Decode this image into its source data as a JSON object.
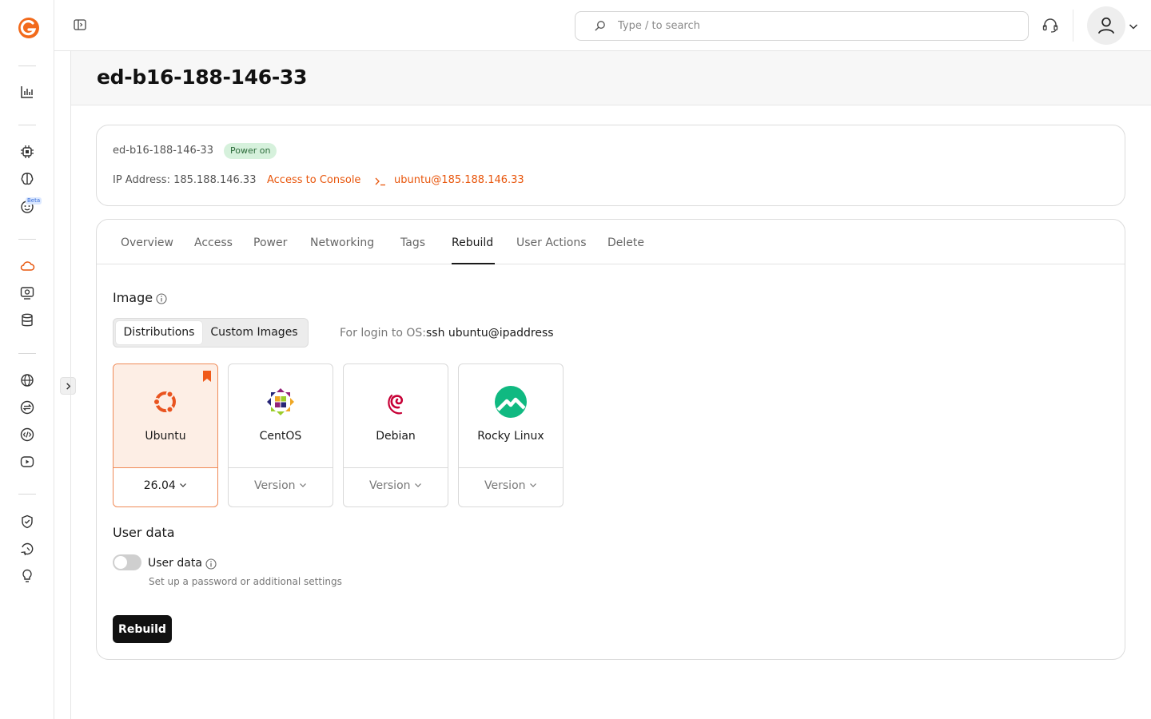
{
  "header": {
    "search_placeholder": "Type / to search"
  },
  "page": {
    "title": "ed-b16-188-146-33"
  },
  "server": {
    "hostname": "ed-b16-188-146-33",
    "status": "Power on",
    "ip_label": "IP Address: 185.188.146.33",
    "console_link": "Access to Console",
    "ssh_link": "ubuntu@185.188.146.33"
  },
  "sidebar": {
    "beta_badge": "Beta",
    "icons": [
      "logo-icon",
      "analytics-icon",
      "chip-icon",
      "brain-icon",
      "bot-icon",
      "cloud-icon",
      "monitor-icon",
      "database-icon",
      "globe-icon",
      "transfer-icon",
      "code-icon",
      "media-icon",
      "shield-icon",
      "recovery-icon",
      "bulb-icon"
    ]
  },
  "tabs": [
    {
      "label": "Overview"
    },
    {
      "label": "Access"
    },
    {
      "label": "Power"
    },
    {
      "label": "Networking"
    },
    {
      "label": "Tags"
    },
    {
      "label": "Rebuild"
    },
    {
      "label": "User Actions"
    },
    {
      "label": "Delete"
    }
  ],
  "active_tab": "Rebuild",
  "image_section": {
    "title": "Image",
    "segments": [
      "Distributions",
      "Custom Images"
    ],
    "active_segment": "Distributions",
    "login_label": "For login to OS:",
    "login_command": "ssh ubuntu@ipaddress",
    "os_options": [
      {
        "name": "Ubuntu",
        "version": "26.04",
        "selected": true
      },
      {
        "name": "CentOS",
        "version": "Version",
        "selected": false
      },
      {
        "name": "Debian",
        "version": "Version",
        "selected": false
      },
      {
        "name": "Rocky Linux",
        "version": "Version",
        "selected": false
      }
    ]
  },
  "user_data": {
    "title": "User data",
    "toggle_label": "User data",
    "toggle_on": false,
    "hint": "Set up a password or additional settings"
  },
  "actions": {
    "rebuild_label": "Rebuild"
  },
  "colors": {
    "accent": "#e8560c",
    "status_bg": "#d6f1dc",
    "primary_button": "#111111",
    "selected_card_bg": "#fdeee5"
  }
}
